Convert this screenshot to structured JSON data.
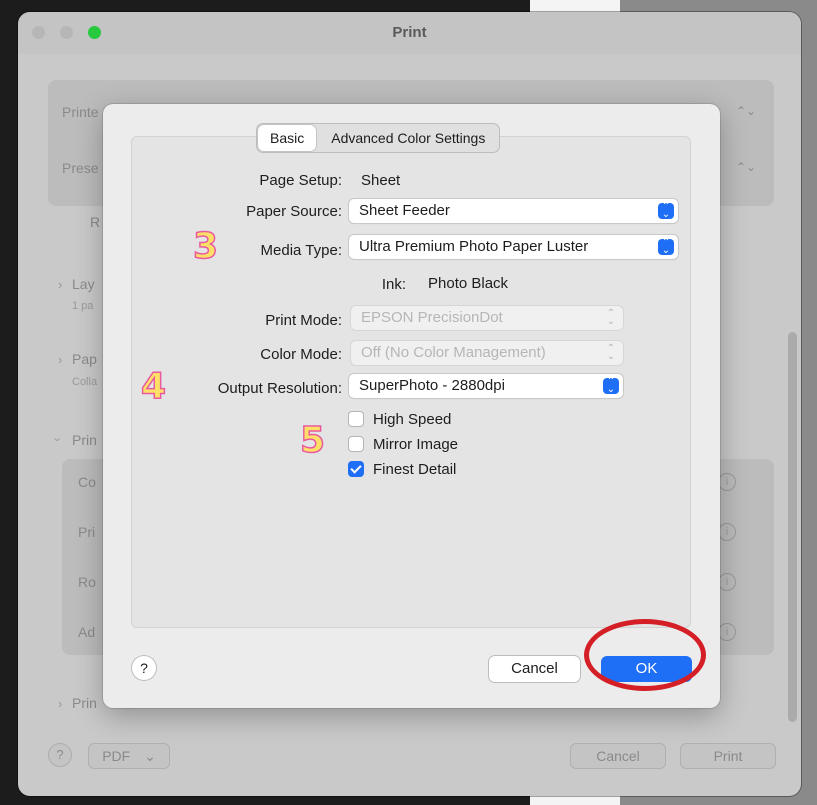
{
  "window": {
    "title": "Print"
  },
  "background": {
    "printer_label": "Printe",
    "presets_label": "Prese",
    "r_label": "R",
    "layout_label": "Lay",
    "layout_sub": "1 pa",
    "paper_label": "Pap",
    "paper_sub": "Colla",
    "print_label": "Prin",
    "rows": [
      "Co",
      "Pri",
      "Ro",
      "Ad"
    ],
    "printer_section_label": "Prin",
    "help": "?",
    "pdf": "PDF",
    "pdf_arrow": "⌄",
    "cancel": "Cancel",
    "print": "Print",
    "info": "i"
  },
  "sheet": {
    "tabs": [
      "Basic",
      "Advanced Color Settings"
    ],
    "page_setup": {
      "label": "Page Setup:",
      "value": "Sheet"
    },
    "paper_source": {
      "label": "Paper Source:",
      "value": "Sheet Feeder"
    },
    "media_type": {
      "label": "Media Type:",
      "value": "Ultra Premium Photo Paper Luster"
    },
    "ink": {
      "label": "Ink:",
      "value": "Photo Black"
    },
    "print_mode": {
      "label": "Print Mode:",
      "value": "EPSON PrecisionDot"
    },
    "color_mode": {
      "label": "Color Mode:",
      "value": "Off (No Color Management)"
    },
    "output_resolution": {
      "label": "Output Resolution:",
      "value": "SuperPhoto - 2880dpi"
    },
    "checkboxes": [
      {
        "label": "High Speed",
        "checked": false
      },
      {
        "label": "Mirror Image",
        "checked": false
      },
      {
        "label": "Finest Detail",
        "checked": true
      }
    ],
    "help": "?",
    "cancel": "Cancel",
    "ok": "OK"
  },
  "annotations": [
    "3",
    "4",
    "5"
  ],
  "colors": {
    "accent": "#1e6ff5",
    "highlight_ring": "#d41f26",
    "annotation_fill": "#ffe066",
    "annotation_stroke": "#e85aa0"
  }
}
